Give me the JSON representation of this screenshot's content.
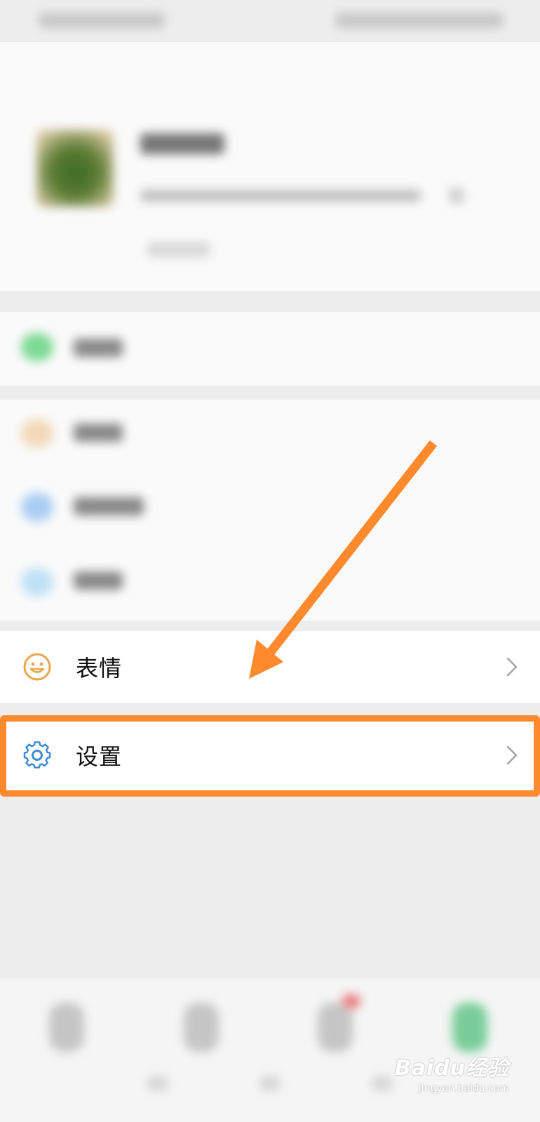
{
  "menu": {
    "items": [
      {
        "label": "表情",
        "icon": "smiley-icon"
      },
      {
        "label": "设置",
        "icon": "gear-icon"
      }
    ]
  },
  "annotation": {
    "arrow_color": "#ff8a2d",
    "highlight_color": "#ff8a2d"
  },
  "watermark": {
    "brand": "Baidu经验",
    "site": "jingyan.baidu.com"
  }
}
